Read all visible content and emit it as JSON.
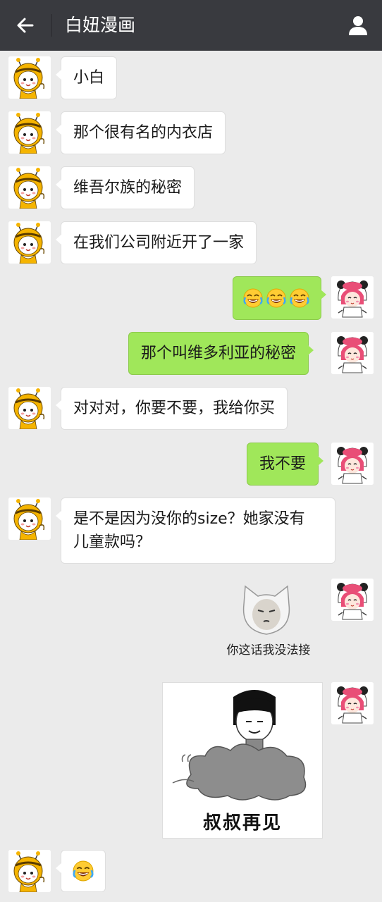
{
  "header": {
    "title": "白妞漫画",
    "back_icon": "arrow-left-icon",
    "profile_icon": "person-icon"
  },
  "contacts": {
    "left_avatar": "bee-girl-avatar",
    "right_avatar": "panda-hood-girl-avatar"
  },
  "messages": [
    {
      "side": "left",
      "text": "小白"
    },
    {
      "side": "left",
      "text": "那个很有名的内衣店"
    },
    {
      "side": "left",
      "text": "维吾尔族的秘密"
    },
    {
      "side": "left",
      "text": "在我们公司附近开了一家"
    },
    {
      "side": "right",
      "emoji": [
        "😂",
        "😂",
        "😂"
      ]
    },
    {
      "side": "right",
      "text": "那个叫维多利亚的秘密"
    },
    {
      "side": "left",
      "text": "对对对，你要不要，我给你买"
    },
    {
      "side": "right",
      "text": "我不要"
    },
    {
      "side": "left",
      "text_line1": "是不是因为没你的size？她家没有",
      "text_line2": "儿童款吗？"
    },
    {
      "side": "right",
      "sticker": "cat-face-sticker",
      "caption": "你这话我没法接"
    },
    {
      "side": "right",
      "sticker": "cloud-man-sticker",
      "caption": "叔叔再见"
    },
    {
      "side": "left",
      "emoji": [
        "😂"
      ]
    }
  ],
  "colors": {
    "header_bg": "#393a3f",
    "chat_bg": "#ebebeb",
    "outgoing_bubble": "#a0e75a",
    "incoming_bubble": "#ffffff"
  }
}
